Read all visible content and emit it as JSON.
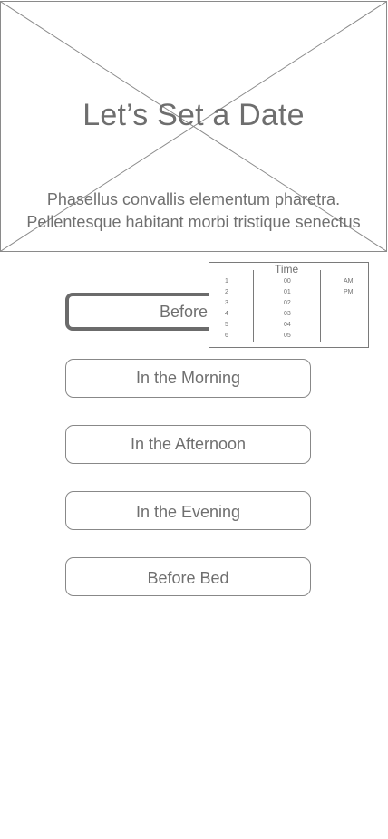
{
  "hero": {
    "title": "Let’s Set a Date",
    "subtitle_line1": "Phasellus convallis elementum pharetra.",
    "subtitle_line2": "Pellentesque habitant morbi tristique senectus"
  },
  "options": {
    "before_wake": "Before W",
    "morning": "In the Morning",
    "afternoon": "In the Afternoon",
    "evening": "In the Evening",
    "bed": "Before Bed"
  },
  "time_picker": {
    "title": "Time",
    "hours": [
      "1",
      "2",
      "3",
      "4",
      "5",
      "6"
    ],
    "minutes": [
      "00",
      "01",
      "02",
      "03",
      "04",
      "05"
    ],
    "ampm": [
      "AM",
      "PM"
    ]
  },
  "colors": {
    "border": "#888888",
    "text": "#707070",
    "selected_border": "#6b6b6b"
  }
}
